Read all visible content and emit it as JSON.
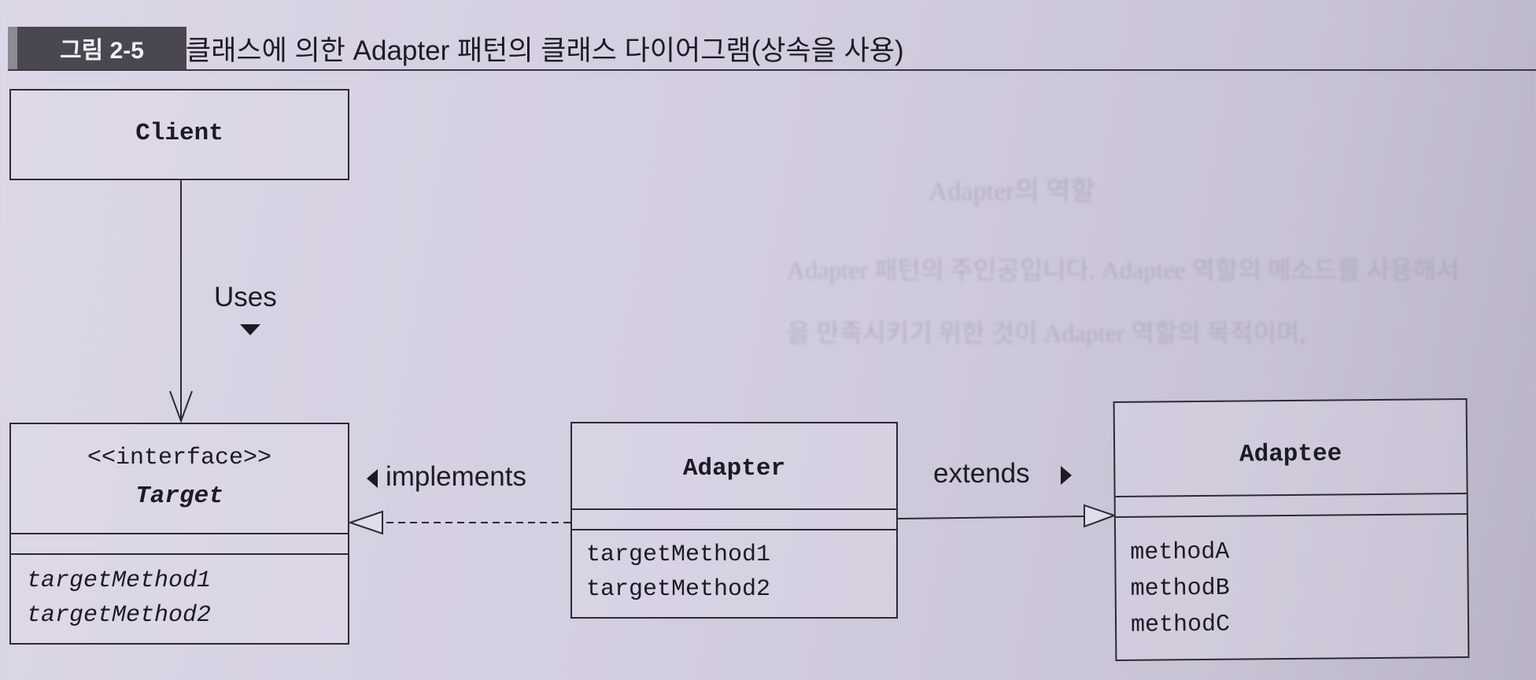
{
  "figure": {
    "label": "그림 2-5",
    "title": "클래스에 의한 Adapter 패턴의 클래스 다이어그램(상속을 사용)"
  },
  "classes": {
    "client": {
      "name": "Client"
    },
    "target": {
      "stereotype": "<<interface>>",
      "name": "Target",
      "methods": [
        "targetMethod1",
        "targetMethod2"
      ]
    },
    "adapter": {
      "name": "Adapter",
      "methods": [
        "targetMethod1",
        "targetMethod2"
      ]
    },
    "adaptee": {
      "name": "Adaptee",
      "methods": [
        "methodA",
        "methodB",
        "methodC"
      ]
    }
  },
  "relations": {
    "uses": "Uses",
    "implements": "implements",
    "extends": "extends"
  },
  "colors": {
    "line": "#2c2a33",
    "label_bg": "#4a4750",
    "page": "#d3cee0"
  }
}
